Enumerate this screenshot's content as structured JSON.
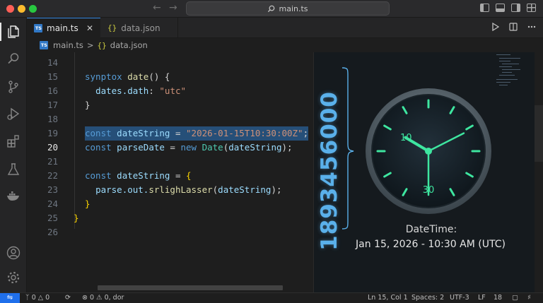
{
  "window": {
    "search_text": "main.ts"
  },
  "tabs": [
    {
      "label": "main.ts",
      "badge": "TS"
    },
    {
      "label": "data.json",
      "badge": "{}"
    }
  ],
  "breadcrumb": {
    "file": "main.ts",
    "file_badge": "TS",
    "separator": ">",
    "symbol_badge": "{}",
    "symbol": "data.json"
  },
  "editor": {
    "lines": [
      {
        "n": "14"
      },
      {
        "n": "15"
      },
      {
        "n": "16"
      },
      {
        "n": "17"
      },
      {
        "n": "18"
      },
      {
        "n": "19"
      },
      {
        "n": "20"
      },
      {
        "n": "21"
      },
      {
        "n": "22"
      },
      {
        "n": "23"
      },
      {
        "n": "24"
      },
      {
        "n": "25"
      },
      {
        "n": "26"
      }
    ],
    "code": {
      "l15_kw": "synptox",
      "l15_fn": "date",
      "l15_rest": "() {",
      "l16_var": "dates.dath",
      "l16_colon": ": ",
      "l16_str": "\"utc\"",
      "l17": "}",
      "l19_kw": "const",
      "l19_var": "dateString",
      "l19_eq": " = ",
      "l19_str": "\"2026-01-15T10:30:00Z\"",
      "l19_end": ";",
      "l20_kw": "const",
      "l20_var": "parseDate",
      "l20_eq": " = ",
      "l20_new": "new",
      "l20_cls": "Date",
      "l20_open": "(",
      "l20_arg": "dateString",
      "l20_end": ");",
      "l22_kw": "const",
      "l22_var": "dateString",
      "l22_eq": " = ",
      "l22_brace": "{",
      "l23_var": "parse.out.",
      "l23_fn": "srlighLasser",
      "l23_open": "(",
      "l23_arg": "dateString",
      "l23_end": ");",
      "l24": "}",
      "l25": "}"
    }
  },
  "panel": {
    "timestamp": "1893456000",
    "caption_title": "DateTime:",
    "caption_date": "Jan 15, 2026 - 10:30 AM (UTC)",
    "clock": {
      "label_top": "10",
      "label_bottom": "30",
      "hour": 10,
      "minute": 30,
      "accent": "#3ee6a0"
    }
  },
  "statusbar": {
    "errors": "0",
    "warnings": "0",
    "problems": "⊗ 0 ⚠ 0, dor",
    "position": "Ln 15, Col 1",
    "spaces": "Spaces: 2",
    "encoding": "UTF-3",
    "eol": "LF",
    "extra": "18"
  },
  "colors": {
    "accent": "#1f6feb",
    "selection": "#264f78"
  }
}
